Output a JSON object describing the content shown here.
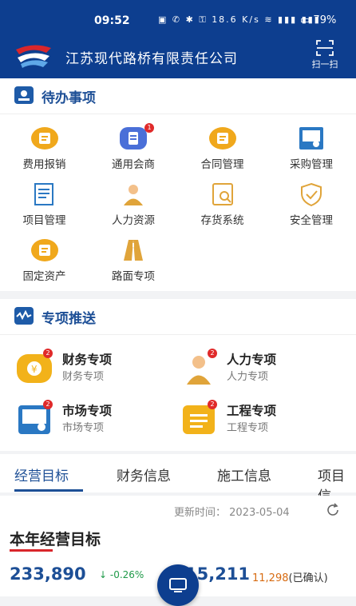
{
  "status": {
    "time": "09:52",
    "net_speed": "18.6 K/s",
    "battery": "79%"
  },
  "header": {
    "company": "江苏现代路桥有限责任公司",
    "scan_label": "扫一扫"
  },
  "todo": {
    "title": "待办事项",
    "items": [
      {
        "label": "费用报销",
        "icon": "receipt-icon",
        "color": "#f0a81c"
      },
      {
        "label": "通用会商",
        "icon": "document-icon",
        "color": "#4a6fd8",
        "badge": "1"
      },
      {
        "label": "合同管理",
        "icon": "contract-icon",
        "color": "#f0a81c"
      },
      {
        "label": "采购管理",
        "icon": "purchase-icon",
        "color": "#2a78c3"
      },
      {
        "label": "项目管理",
        "icon": "project-icon",
        "color": "#2a78c3"
      },
      {
        "label": "人力资源",
        "icon": "person-icon",
        "color": "#e0a43a"
      },
      {
        "label": "存货系统",
        "icon": "inventory-icon",
        "color": "#e0a43a"
      },
      {
        "label": "安全管理",
        "icon": "shield-icon",
        "color": "#e0a43a"
      },
      {
        "label": "固定资产",
        "icon": "assets-icon",
        "color": "#f0a81c"
      },
      {
        "label": "路面专项",
        "icon": "road-icon",
        "color": "#e0a43a"
      }
    ]
  },
  "push": {
    "title": "专项推送",
    "items": [
      {
        "title": "财务专项",
        "subtitle": "财务专项",
        "badge": "2",
        "icon": "finance-icon"
      },
      {
        "title": "人力专项",
        "subtitle": "人力专项",
        "badge": "2",
        "icon": "person-icon"
      },
      {
        "title": "市场专项",
        "subtitle": "市场专项",
        "badge": "2",
        "icon": "market-icon"
      },
      {
        "title": "工程专项",
        "subtitle": "工程专项",
        "badge": "2",
        "icon": "engineering-icon"
      }
    ]
  },
  "tabs": [
    "经营目标",
    "财务信息",
    "施工信息",
    "项目信"
  ],
  "goal": {
    "update_label": "更新时间：",
    "update_date": "2023-05-04",
    "title": "本年经营目标",
    "value": "233,890",
    "delta": "↓ -0.26%",
    "value2": "15,211",
    "confirmed_value": "11,298",
    "confirmed_label": "(已确认)"
  }
}
